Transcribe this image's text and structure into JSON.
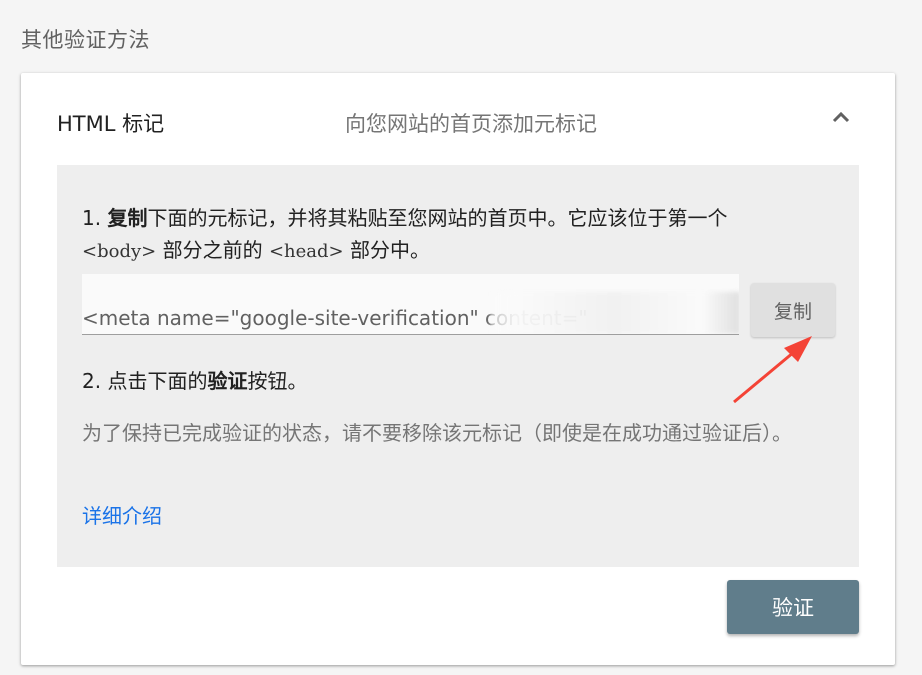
{
  "section_heading": "其他验证方法",
  "method": {
    "name": "HTML 标记",
    "description": "向您网站的首页添加元标记",
    "collapse_icon": "chevron-up-icon"
  },
  "step1": {
    "number": "1.",
    "bold": "复制",
    "text_after_bold": "下面的元标记，并将其粘贴至您网站的首页中。它应该位于第一个",
    "tag_body": "<body>",
    "text_mid": "部分之前的",
    "tag_head": "<head>",
    "text_end": "部分中。"
  },
  "meta_tag_code": "<meta name=\"google-site-verification\" content=\"",
  "copy_button_label": "复制",
  "step2": {
    "number": "2.",
    "text_before": "点击下面的",
    "bold": "验证",
    "text_after": "按钮。"
  },
  "note": "为了保持已完成验证的状态，请不要移除该元标记（即使是在成功通过验证后）。",
  "learn_more_label": "详细介绍",
  "verify_button_label": "验证",
  "colors": {
    "verify_button": "#607d8b",
    "link": "#1a73e8",
    "annotation_arrow": "#f44336"
  }
}
